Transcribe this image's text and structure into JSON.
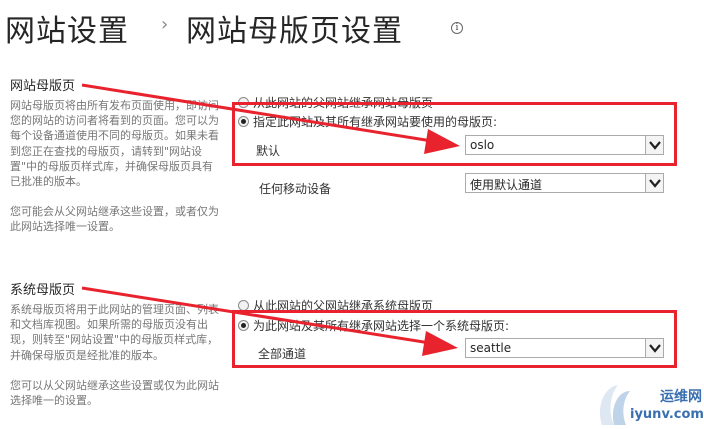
{
  "header": {
    "breadcrumb_parent": "网站设置",
    "breadcrumb_current": "网站母版页设置",
    "info_icon": "info-icon"
  },
  "site_master": {
    "title": "网站母版页",
    "description_1": "网站母版页将由所有发布页面使用，即访问您的网站的访问者将看到的页面。您可以为每个设备通道使用不同的母版页。如果未看到您正在查找的母版页，请转到\"网站设置\"中的母版页样式库，并确保母版页具有已批准的版本。",
    "description_2": "您可能会从父网站继承这些设置，或者仅为此网站选择唯一设置。",
    "option_inherit": "从此网站的父网站继承网站母版页",
    "option_specify": "指定此网站及其所有继承网站要使用的母版页:",
    "default_label": "默认",
    "default_value": "oslo",
    "mobile_label": "任何移动设备",
    "mobile_value": "使用默认通道"
  },
  "system_master": {
    "title": "系统母版页",
    "description_1": "系统母版页将用于此网站的管理页面、列表和文档库视图。如果所需的母版页没有出现，则转至\"网站设置\"中的母版页样式库，并确保母版页是经批准的版本。",
    "description_2": "您可以从父网站继承这些设置或仅为此网站选择唯一的设置。",
    "option_inherit": "从此网站的父网站继承系统母版页",
    "option_specify": "为此网站及其所有继承网站选择一个系统母版页:",
    "all_channels_label": "全部通道",
    "all_channels_value": "seattle"
  },
  "watermark": {
    "brand": "运维网",
    "domain": "iyunv.com"
  },
  "colors": {
    "highlight": "#e8232d",
    "watermark": "#3a6fb0"
  }
}
